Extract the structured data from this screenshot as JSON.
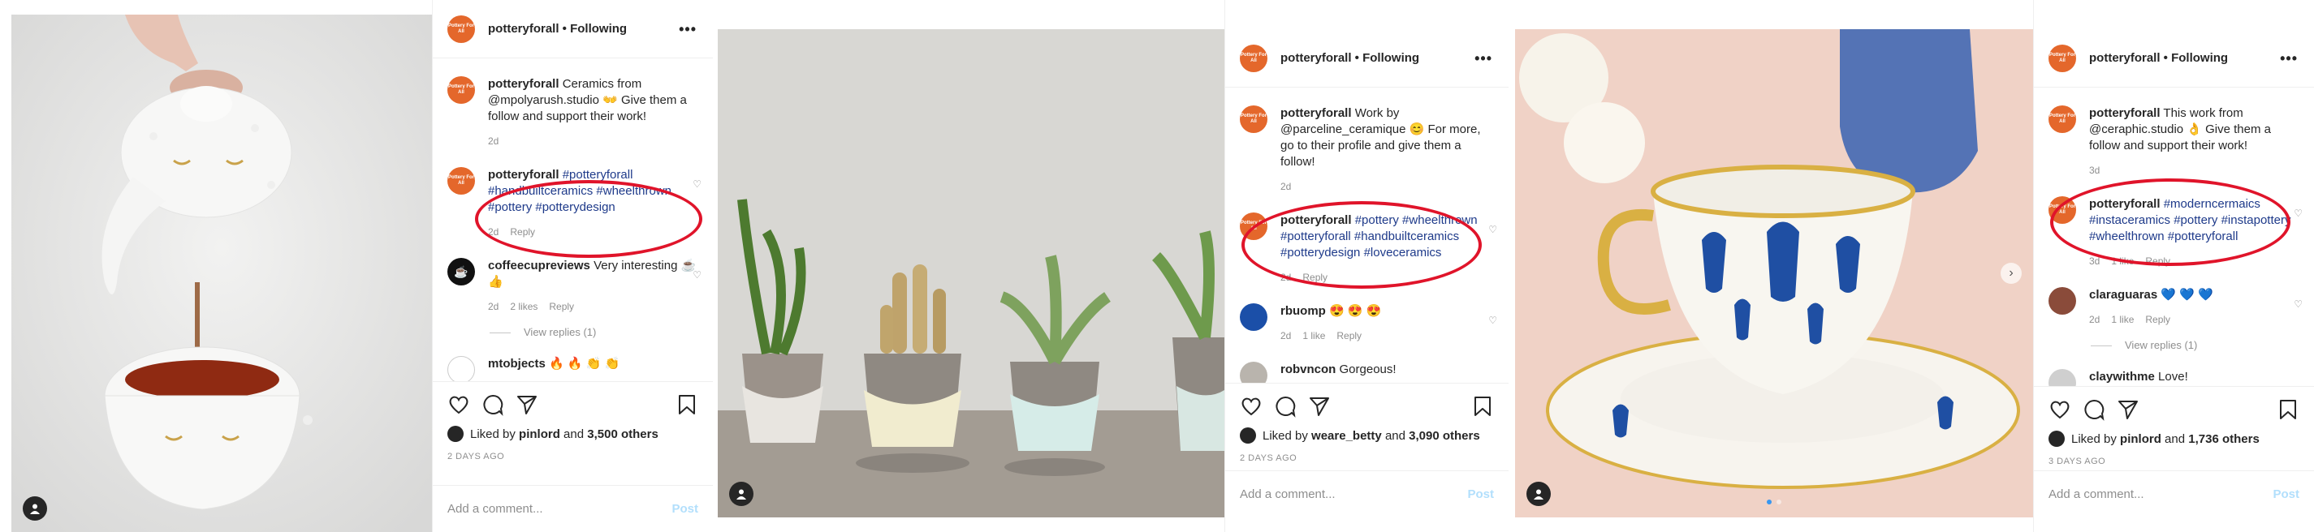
{
  "common": {
    "account": "potteryforall • Following",
    "logo_text": "Pottery For All",
    "add_comment_placeholder": "Add a comment...",
    "post_label": "Post",
    "liked_prefix": "Liked by",
    "liked_and": "and",
    "brand_color": "#e4672b",
    "highlight_color": "#e0142a",
    "hashtag_color": "#1e3a8a"
  },
  "posts": [
    {
      "caption_user": "potteryforall",
      "caption_text": "Ceramics from @mpolyarush.studio 👐 Give them a follow and support their work!",
      "caption_age": "2d",
      "tag_user": "potteryforall",
      "tag_text": "#potteryforall #handbuiltceramics #wheelthrown #pottery #potterydesign",
      "tag_age": "2d",
      "tag_reply": "Reply",
      "c1_user": "coffeecupreviews",
      "c1_text": "Very interesting ☕ 👍",
      "c1_meta": [
        "2d",
        "2 likes",
        "Reply"
      ],
      "view_replies": "View replies (1)",
      "c2_user": "mtobjects",
      "c2_text": "🔥 🔥 👏 👏",
      "liked_user": "pinlord",
      "liked_count": "3,500 others",
      "date": "2 DAYS AGO"
    },
    {
      "caption_user": "potteryforall",
      "caption_text": "Work by @parceline_ceramique 😊 For more, go to their profile and give them a follow!",
      "caption_age": "2d",
      "tag_user": "potteryforall",
      "tag_text": "#pottery #wheelthrown #potteryforall #handbuiltceramics #potterydesign #loveceramics",
      "tag_age": "2d",
      "tag_reply": "Reply",
      "c1_user": "rbuomp",
      "c1_text": "😍 😍 😍",
      "c1_meta": [
        "2d",
        "1 like",
        "Reply"
      ],
      "c2_user": "robvncon",
      "c2_text": "Gorgeous!",
      "liked_user": "weare_betty",
      "liked_count": "3,090 others",
      "date": "2 DAYS AGO"
    },
    {
      "caption_user": "potteryforall",
      "caption_text": "This work from @ceraphic.studio 👌 Give them a follow and support their work!",
      "caption_age": "3d",
      "tag_user": "potteryforall",
      "tag_text": "#moderncermaics #instaceramics #pottery #instapottery #wheelthrown #potteryforall",
      "tag_meta": [
        "3d",
        "1 like",
        "Reply"
      ],
      "c1_user": "claraguaras",
      "c1_text": "💙 💙 💙",
      "c1_meta": [
        "2d",
        "1 like",
        "Reply"
      ],
      "view_replies": "View replies (1)",
      "c2_user": "claywithme",
      "c2_text": "Love!",
      "liked_user": "pinlord",
      "liked_count": "1,736 others",
      "date": "3 DAYS AGO"
    }
  ]
}
